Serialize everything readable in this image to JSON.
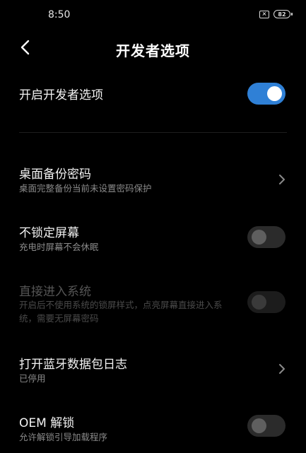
{
  "status_bar": {
    "time": "8:50",
    "battery_level": "82"
  },
  "header": {
    "title": "开发者选项"
  },
  "settings": {
    "developer_options": {
      "title": "开启开发者选项",
      "enabled": true
    },
    "desktop_backup_password": {
      "title": "桌面备份密码",
      "subtitle": "桌面完整备份当前未设置密码保护"
    },
    "stay_awake": {
      "title": "不锁定屏幕",
      "subtitle": "充电时屏幕不会休眠",
      "enabled": false
    },
    "direct_enter_system": {
      "title": "直接进入系统",
      "subtitle": "开启后不使用系统的锁屏样式，点亮屏幕直接进入系统，需要无屏幕密码",
      "enabled": false,
      "available": false
    },
    "bluetooth_hci_log": {
      "title": "打开蓝牙数据包日志",
      "subtitle": "已停用"
    },
    "oem_unlock": {
      "title": "OEM 解锁",
      "subtitle": "允许解锁引导加载程序",
      "enabled": false
    }
  },
  "colors": {
    "background": "#000000",
    "accent": "#2f80d6",
    "text_primary": "#f2f2f2",
    "text_secondary": "#8a8a8a"
  }
}
